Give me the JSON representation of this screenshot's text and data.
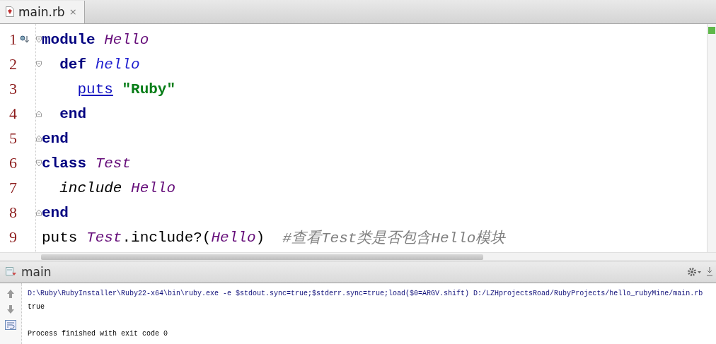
{
  "editor_tab": {
    "title": "main.rb",
    "close": "×",
    "selected": true
  },
  "code_lines": [
    {
      "number": "1",
      "kind": "fold_start",
      "tokens": [
        {
          "text": "module",
          "kind": "keyword"
        },
        {
          "text": " Hello",
          "kind": "constant"
        }
      ]
    },
    {
      "number": "2",
      "kind": "fold_start",
      "tokens": [
        {
          "text": "  def",
          "kind": "keyword"
        },
        {
          "text": " hello",
          "kind": "method"
        }
      ]
    },
    {
      "number": "3",
      "kind": "plain",
      "tokens": [
        {
          "text": "    puts",
          "kind": "call"
        },
        {
          "text": " \"Ruby\"",
          "kind": "string"
        }
      ]
    },
    {
      "number": "4",
      "kind": "fold_end",
      "tokens": [
        {
          "text": "  end",
          "kind": "keyword"
        }
      ]
    },
    {
      "number": "5",
      "kind": "fold_end",
      "tokens": [
        {
          "text": "end",
          "kind": "keyword"
        }
      ]
    },
    {
      "number": "6",
      "kind": "fold_start",
      "tokens": [
        {
          "text": "class",
          "kind": "keyword"
        },
        {
          "text": " Test",
          "kind": "constant"
        }
      ]
    },
    {
      "number": "7",
      "kind": "plain",
      "tokens": [
        {
          "text": "  include",
          "kind": "builtin"
        },
        {
          "text": " Hello",
          "kind": "constant"
        }
      ]
    },
    {
      "number": "8",
      "kind": "fold_end",
      "tokens": [
        {
          "text": "end",
          "kind": "keyword"
        }
      ]
    },
    {
      "number": "9",
      "kind": "plain",
      "tokens": [
        {
          "text": "puts",
          "kind": "plain"
        },
        {
          "text": " Test",
          "kind": "constant"
        },
        {
          "text": ".include?(",
          "kind": "plain"
        },
        {
          "text": "Hello",
          "kind": "constant"
        },
        {
          "text": ")",
          "kind": "plain"
        },
        {
          "text": "  #查看Test类是否包含Hello模块",
          "kind": "comment"
        }
      ]
    }
  ],
  "run_panel": {
    "title": "main",
    "output": [
      {
        "text": "D:\\Ruby\\RubyInstaller\\Ruby22-x64\\bin\\ruby.exe -e $stdout.sync=true;$stderr.sync=true;load($0=ARGV.shift) D:/LZHprojectsRoad/RubyProjects/hello_rubyMine/main.rb",
        "kind": "command"
      },
      {
        "text": "true",
        "kind": "output"
      },
      {
        "kind": "blank"
      },
      {
        "text": "Process finished with exit code 0",
        "kind": "output"
      }
    ]
  }
}
